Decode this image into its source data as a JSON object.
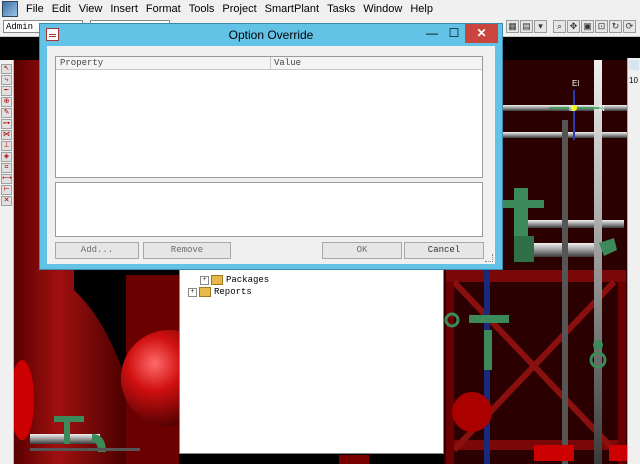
{
  "menu": {
    "items": [
      "File",
      "Edit",
      "View",
      "Insert",
      "Format",
      "Tools",
      "Project",
      "SmartPlant",
      "Tasks",
      "Window",
      "Help"
    ]
  },
  "toolbar": {
    "user_combo": "Admin"
  },
  "right_panel": {
    "number": "10"
  },
  "tree": {
    "items": [
      {
        "label": "Packages"
      },
      {
        "label": "Reports"
      }
    ]
  },
  "dialog": {
    "title": "Option Override",
    "minimize_glyph": "—",
    "maximize_glyph": "☐",
    "close_glyph": "✕",
    "columns": [
      "Property",
      "Value"
    ],
    "buttons": {
      "add": "Add...",
      "remove": "Remove",
      "ok": "OK",
      "cancel": "Cancel"
    }
  },
  "compass": {
    "el": "El",
    "n": "N",
    "e": "E"
  },
  "colors": {
    "title_bar": "#62c3e6",
    "close_button": "#c9453d",
    "scene_red": "#8b0000",
    "pipe_green": "#3c8a5a"
  }
}
